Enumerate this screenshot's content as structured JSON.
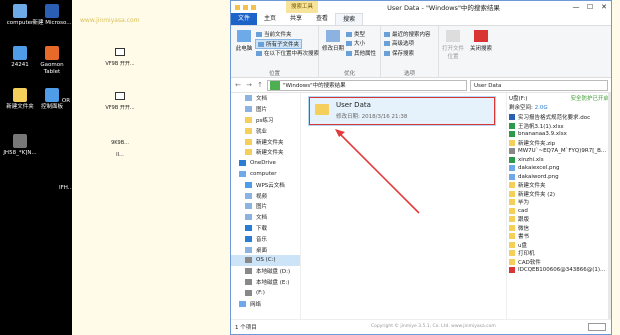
{
  "desktop": {
    "watermark": "www.jinmiyasa.com",
    "icons": [
      {
        "label": "computer",
        "color": "#6ea9e8"
      },
      {
        "label": "新建 Microso...",
        "color": "#2b5fb4"
      },
      {
        "label": "24241",
        "color": "#4f9de8"
      },
      {
        "label": "Gaomon Tablet",
        "color": "#e86a2a"
      },
      {
        "label": "新建文件夹",
        "color": "#f4cf5c"
      },
      {
        "label": "控制面板",
        "color": "#4f9de8"
      },
      {
        "label": "JH58_*K]N...",
        "color": "#777777"
      },
      {
        "label": "OR",
        "color": "#999999"
      },
      {
        "label": "IFH...",
        "color": "#999999"
      }
    ],
    "mid_labels": [
      "VF9B 开开...",
      "VF9B 开开...",
      "9K9B...",
      "II..."
    ]
  },
  "window": {
    "title": "User Data - \"Windows\"中的搜索结果",
    "context_group": "搜索工具",
    "controls": [
      "—",
      "☐",
      "✕"
    ],
    "tabs": [
      "文件",
      "主页",
      "共享",
      "查看",
      "搜索"
    ],
    "ribbon": {
      "location": {
        "big": "此电脑",
        "items": [
          "当前文件夹",
          "所有子文件夹",
          "在以下位置中再次搜索"
        ],
        "label": "位置"
      },
      "refine": {
        "big": "修改日期",
        "items": [
          "类型",
          "大小",
          "其他属性"
        ],
        "label": "优化"
      },
      "options": {
        "items": [
          "最近的搜索内容",
          "高级选项",
          "保存搜索"
        ],
        "label": "选项"
      },
      "open_location": "打开文件位置",
      "close_search": "关闭搜索"
    },
    "address": {
      "nav": [
        "←",
        "→",
        "↑"
      ],
      "path": "\"Windows\"中的搜索结果",
      "search": "User Data"
    },
    "nav_pane": [
      {
        "label": "文档",
        "color": "#8bb2e0",
        "sub": true
      },
      {
        "label": "图片",
        "color": "#8bb2e0",
        "sub": true
      },
      {
        "label": "ps练习",
        "color": "#f4cf5c",
        "sub": true
      },
      {
        "label": "就业",
        "color": "#f4cf5c",
        "sub": true
      },
      {
        "label": "新建文件夹",
        "color": "#f4cf5c",
        "sub": true
      },
      {
        "label": "新建文件夹",
        "color": "#f4cf5c",
        "sub": true
      },
      {
        "label": "OneDrive",
        "color": "#2b7cd3",
        "sub": false
      },
      {
        "label": "computer",
        "color": "#6ea9e8",
        "sub": false
      },
      {
        "label": "WPS云文档",
        "color": "#4f9de8",
        "sub": true
      },
      {
        "label": "视频",
        "color": "#8bb2e0",
        "sub": true
      },
      {
        "label": "图片",
        "color": "#8bb2e0",
        "sub": true
      },
      {
        "label": "文档",
        "color": "#8bb2e0",
        "sub": true
      },
      {
        "label": "下载",
        "color": "#2b7cd3",
        "sub": true
      },
      {
        "label": "音乐",
        "color": "#2b7cd3",
        "sub": true
      },
      {
        "label": "桌面",
        "color": "#8bb2e0",
        "sub": true
      },
      {
        "label": "OS (C:)",
        "color": "#888888",
        "sub": true,
        "selected": true
      },
      {
        "label": "本地磁盘 (D:)",
        "color": "#888888",
        "sub": true
      },
      {
        "label": "本地磁盘 (E:)",
        "color": "#888888",
        "sub": true
      },
      {
        "label": "(F:)",
        "color": "#888888",
        "sub": true
      },
      {
        "label": "网络",
        "color": "#6ea9e8",
        "sub": false
      }
    ],
    "result": {
      "name": "User Data",
      "date": "修改日期: 2018/3/16 21:38"
    },
    "preview": {
      "drive": "U盘(F:)",
      "safe": "安全防护已开启",
      "free_label": "剩余空间:",
      "free_value": "2.0G",
      "items": [
        {
          "label": "实习报告格式规范化要求.doc",
          "color": "#2b5fb4"
        },
        {
          "label": "王浩帆3.1(1).xlsx",
          "color": "#2b9a4a"
        },
        {
          "label": "bnananaa3.9.xlsx",
          "color": "#2b9a4a"
        },
        {
          "label": "新建文件夹.zip",
          "color": "#f4cf5c"
        },
        {
          "label": "MW7U`~EQ7A_M`FYQ)9R7[_B...",
          "color": "#888888"
        },
        {
          "label": "xinzhi.xls",
          "color": "#2b9a4a"
        },
        {
          "label": "dakaiexcel.png",
          "color": "#6ea9e8"
        },
        {
          "label": "dakaiword.png",
          "color": "#6ea9e8"
        },
        {
          "label": "新建文件夹",
          "color": "#f4cf5c"
        },
        {
          "label": "新建文件夹 (2)",
          "color": "#f4cf5c"
        },
        {
          "label": "毕为",
          "color": "#f4cf5c"
        },
        {
          "label": "cad",
          "color": "#f4cf5c"
        },
        {
          "label": "跟版",
          "color": "#f4cf5c"
        },
        {
          "label": "微信",
          "color": "#f4cf5c"
        },
        {
          "label": "書书",
          "color": "#f4cf5c"
        },
        {
          "label": "u盘",
          "color": "#f4cf5c"
        },
        {
          "label": "打印机",
          "color": "#f4cf5c"
        },
        {
          "label": "CAD软件",
          "color": "#f4cf5c"
        },
        {
          "label": "IDCQEB100606@343866@(1)...",
          "color": "#d93535"
        }
      ]
    },
    "status": "1 个项目",
    "footer": "Copyright © jinmiye 3.5.1, Co. Ltd. www.jinmiyasa.com"
  }
}
